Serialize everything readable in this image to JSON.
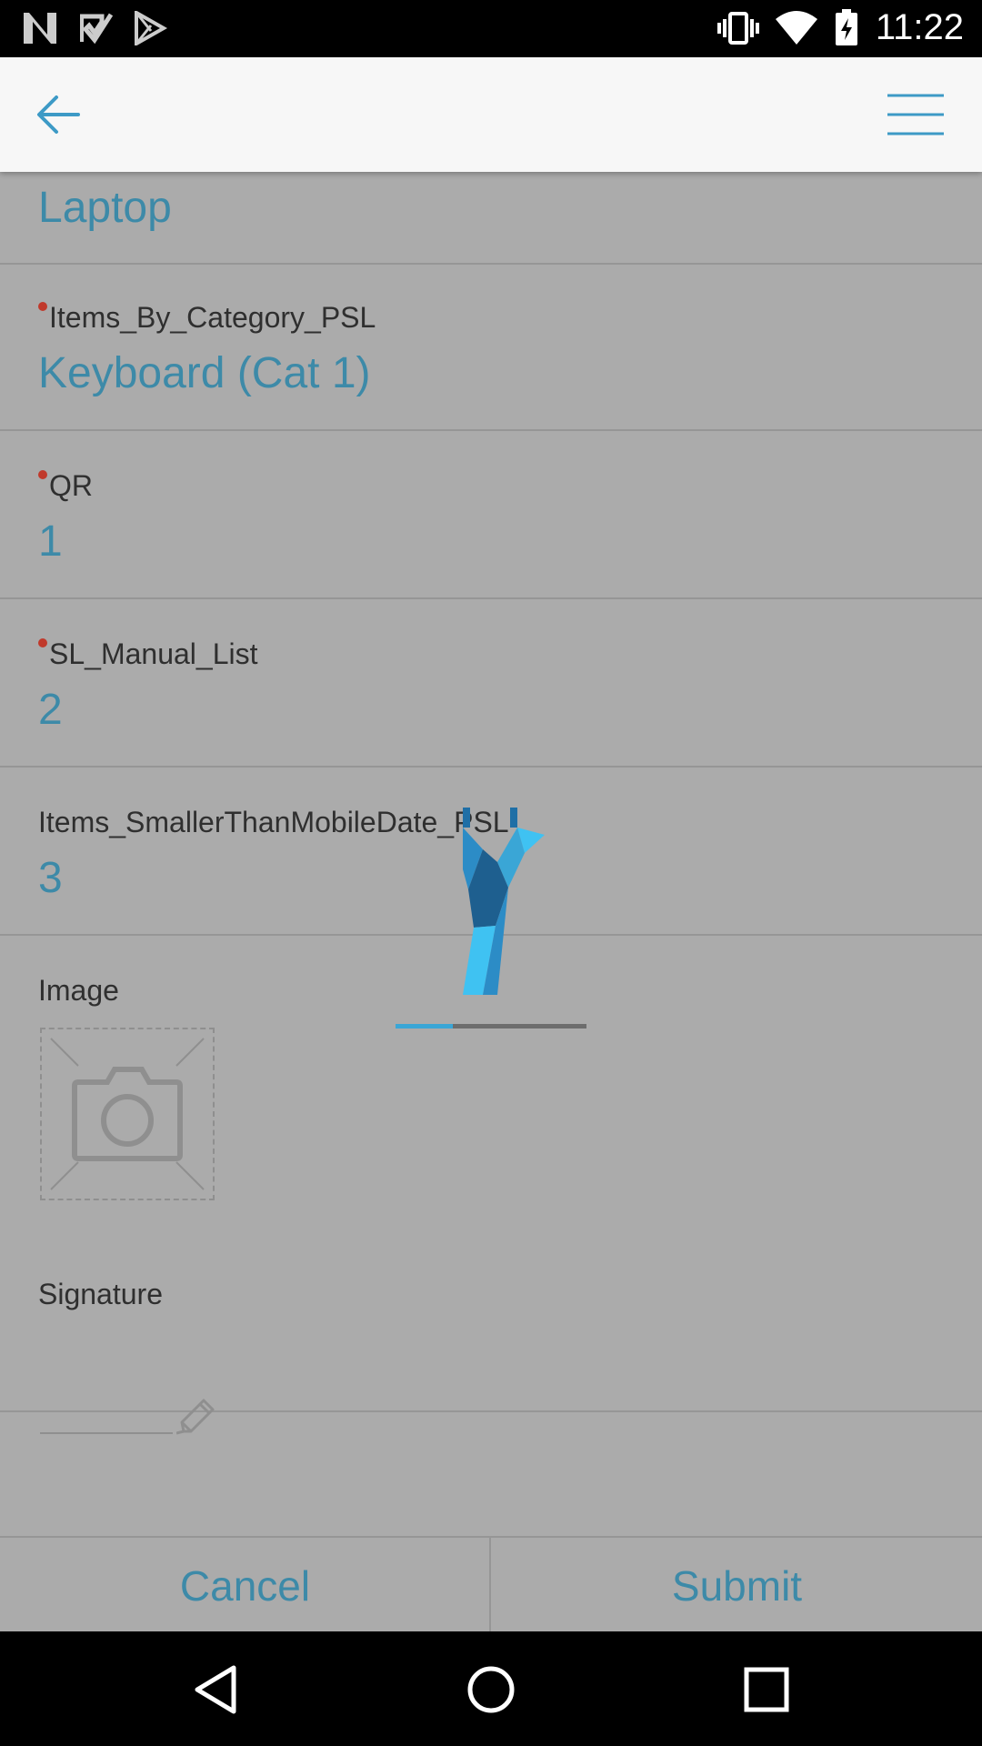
{
  "status_bar": {
    "time": "11:22",
    "left_icons": [
      "notification-n-icon",
      "notification-check-icon",
      "play-store-icon"
    ],
    "right_icons": [
      "vibrate-icon",
      "wifi-icon",
      "battery-charging-icon"
    ]
  },
  "app_bar": {
    "back_icon": "arrow-left-icon",
    "menu_icon": "hamburger-menu-icon"
  },
  "form": {
    "fields": [
      {
        "label": "",
        "value": "Laptop",
        "required": false
      },
      {
        "label": "Items_By_Category_PSL",
        "value": "Keyboard (Cat 1)",
        "required": true
      },
      {
        "label": "QR",
        "value": "1",
        "required": true
      },
      {
        "label": "SL_Manual_List",
        "value": "2",
        "required": true
      },
      {
        "label": "Items_SmallerThanMobileDate_PSL",
        "value": "3",
        "required": false
      }
    ],
    "image": {
      "label": "Image",
      "icon": "camera-icon"
    },
    "signature": {
      "label": "Signature",
      "icon": "pencil-icon"
    }
  },
  "actions": {
    "cancel_label": "Cancel",
    "submit_label": "Submit"
  },
  "loading": {
    "progress": 0.3
  },
  "colors": {
    "accent": "#3d8aa8",
    "required_dot": "#c0392b",
    "overlay_bg": "#ababab"
  }
}
